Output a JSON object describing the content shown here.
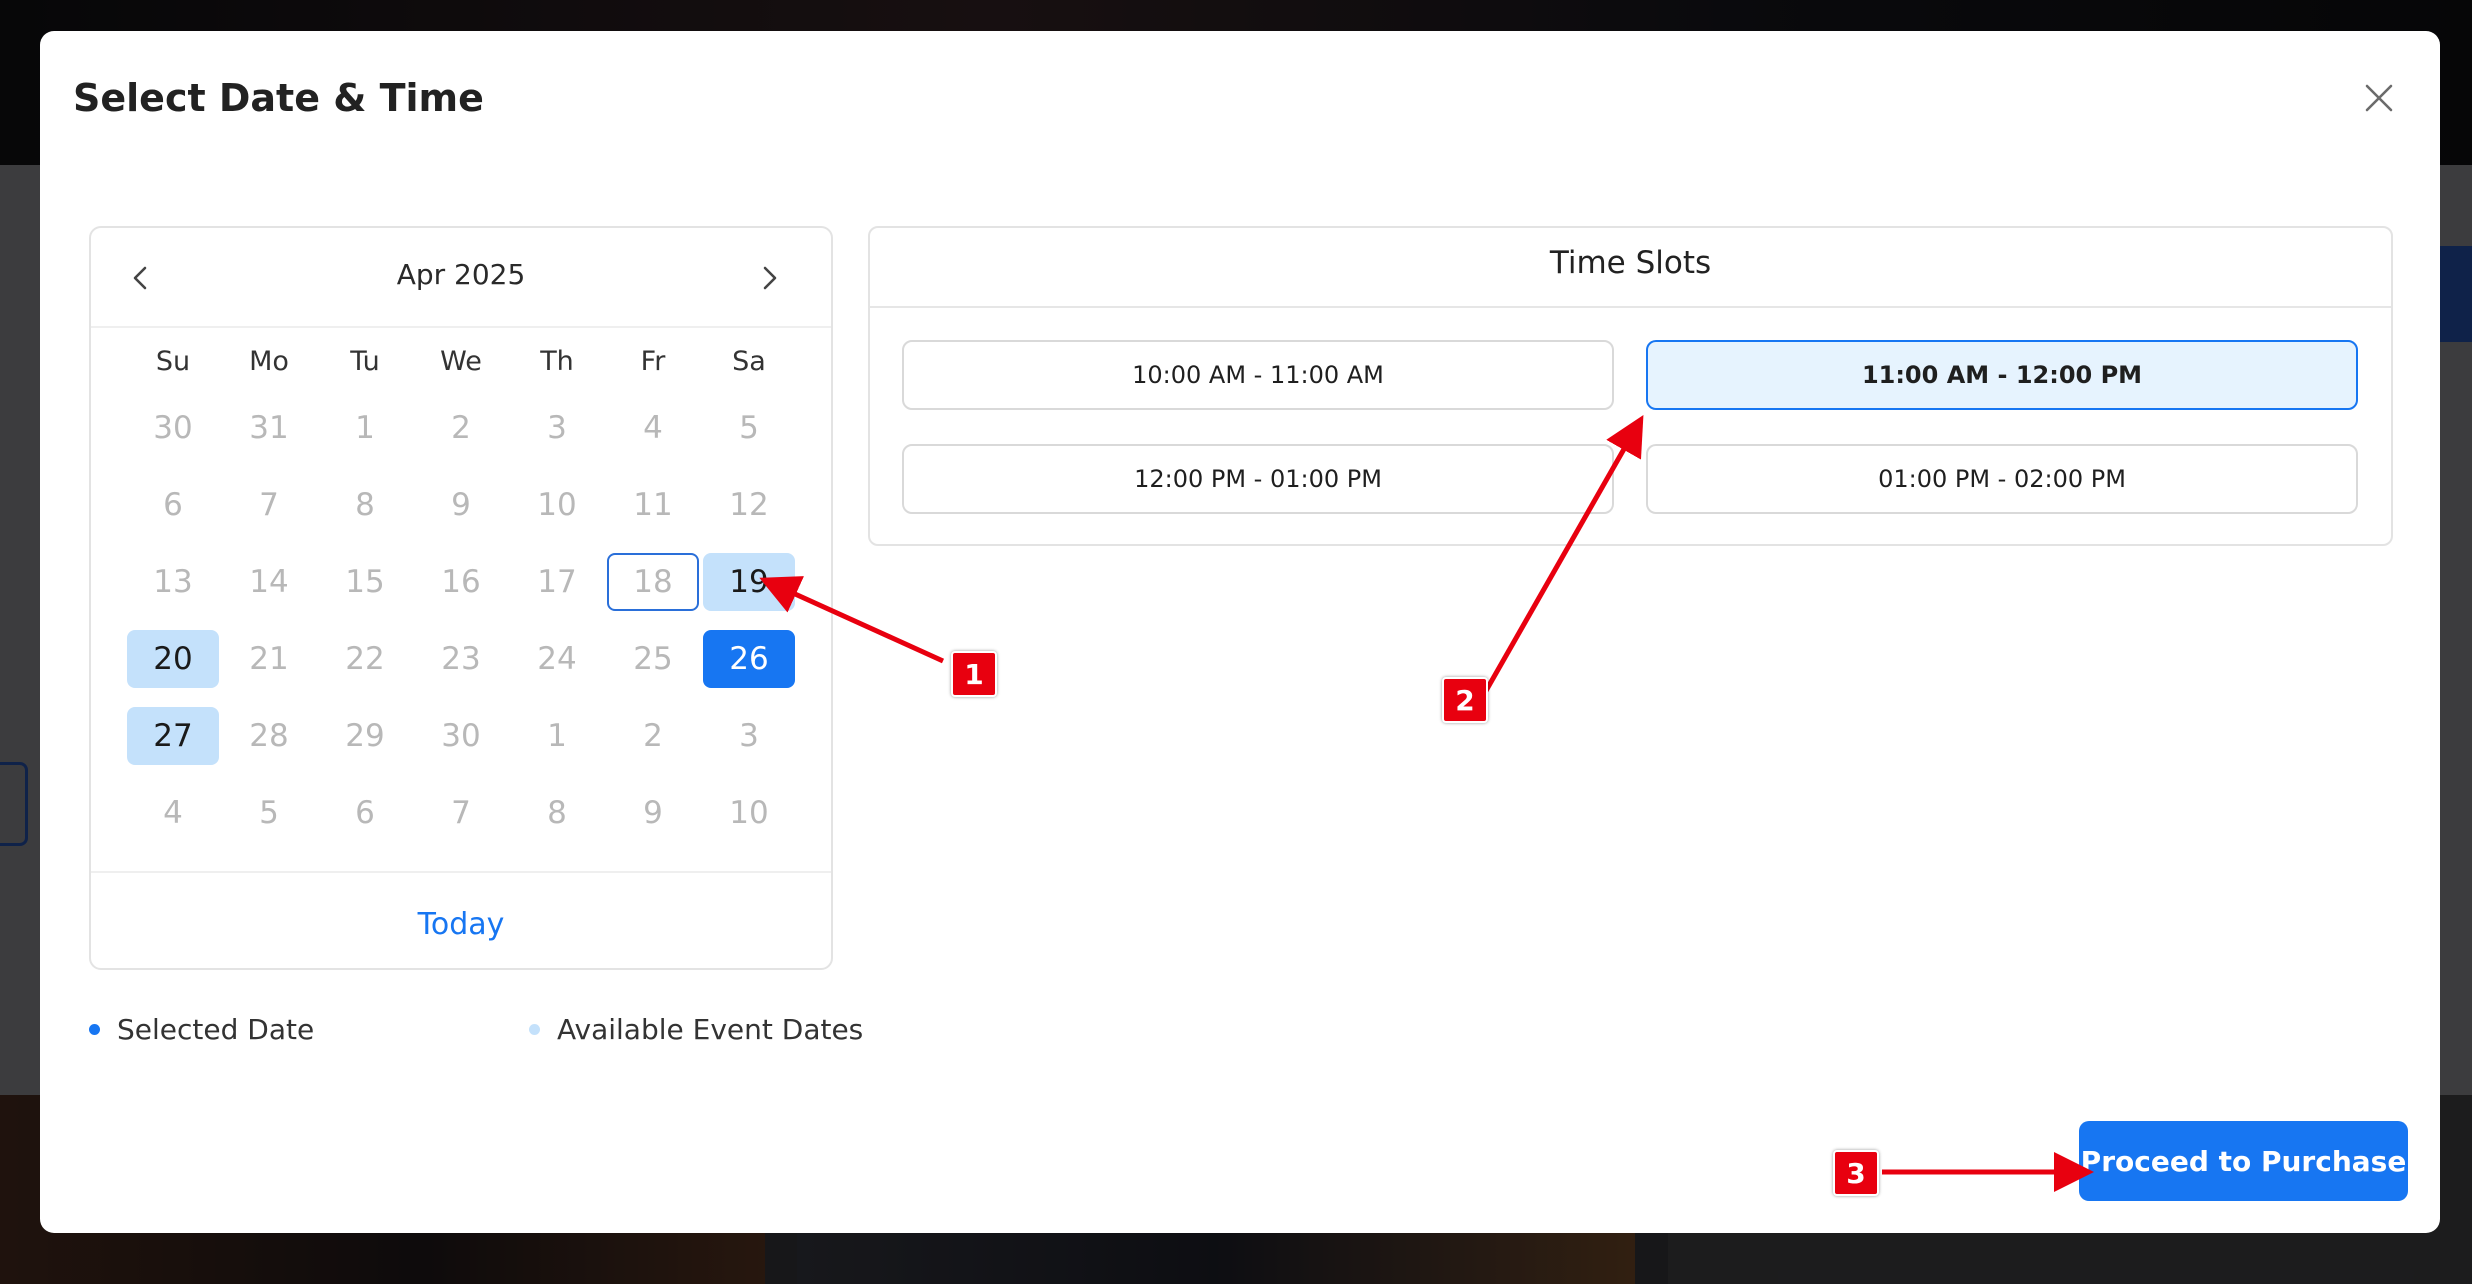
{
  "modal": {
    "title": "Select Date & Time"
  },
  "calendar": {
    "month_label": "Apr 2025",
    "weekdays": [
      "Su",
      "Mo",
      "Tu",
      "We",
      "Th",
      "Fr",
      "Sa"
    ],
    "weeks": [
      [
        "30",
        "31",
        "1",
        "2",
        "3",
        "4",
        "5"
      ],
      [
        "6",
        "7",
        "8",
        "9",
        "10",
        "11",
        "12"
      ],
      [
        "13",
        "14",
        "15",
        "16",
        "17",
        "18",
        "19"
      ],
      [
        "20",
        "21",
        "22",
        "23",
        "24",
        "25",
        "26"
      ],
      [
        "27",
        "28",
        "29",
        "30",
        "1",
        "2",
        "3"
      ],
      [
        "4",
        "5",
        "6",
        "7",
        "8",
        "9",
        "10"
      ]
    ],
    "today_label": "Today",
    "today_date": "18",
    "selected_date": "26",
    "available_dates": [
      "19",
      "20",
      "27"
    ]
  },
  "legend": {
    "selected": "Selected Date",
    "available": "Available Event Dates"
  },
  "time_slots": {
    "title": "Time Slots",
    "slots": [
      {
        "label": "10:00 AM - 11:00 AM",
        "selected": false
      },
      {
        "label": "11:00 AM - 12:00 PM",
        "selected": true
      },
      {
        "label": "12:00 PM - 01:00 PM",
        "selected": false
      },
      {
        "label": "01:00 PM - 02:00 PM",
        "selected": false
      }
    ]
  },
  "actions": {
    "proceed": "Proceed to Purchase"
  },
  "annotations": {
    "badges": [
      "1",
      "2",
      "3"
    ]
  },
  "colors": {
    "accent": "#1776f2",
    "available_bg": "#c4e1fb",
    "slot_active_bg": "#e6f3fe",
    "annotation_red": "#e8000f"
  },
  "icons": {
    "close": "close-icon",
    "prev": "chevron-left-icon",
    "next": "chevron-right-icon"
  }
}
